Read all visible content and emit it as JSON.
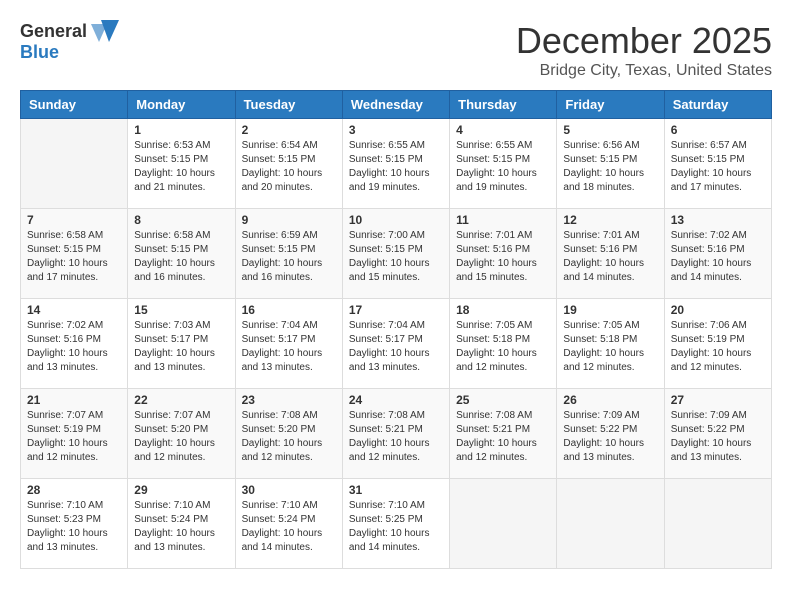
{
  "header": {
    "logo_general": "General",
    "logo_blue": "Blue",
    "month_title": "December 2025",
    "location": "Bridge City, Texas, United States"
  },
  "weekdays": [
    "Sunday",
    "Monday",
    "Tuesday",
    "Wednesday",
    "Thursday",
    "Friday",
    "Saturday"
  ],
  "weeks": [
    [
      {
        "day": "",
        "info": ""
      },
      {
        "day": "1",
        "info": "Sunrise: 6:53 AM\nSunset: 5:15 PM\nDaylight: 10 hours\nand 21 minutes."
      },
      {
        "day": "2",
        "info": "Sunrise: 6:54 AM\nSunset: 5:15 PM\nDaylight: 10 hours\nand 20 minutes."
      },
      {
        "day": "3",
        "info": "Sunrise: 6:55 AM\nSunset: 5:15 PM\nDaylight: 10 hours\nand 19 minutes."
      },
      {
        "day": "4",
        "info": "Sunrise: 6:55 AM\nSunset: 5:15 PM\nDaylight: 10 hours\nand 19 minutes."
      },
      {
        "day": "5",
        "info": "Sunrise: 6:56 AM\nSunset: 5:15 PM\nDaylight: 10 hours\nand 18 minutes."
      },
      {
        "day": "6",
        "info": "Sunrise: 6:57 AM\nSunset: 5:15 PM\nDaylight: 10 hours\nand 17 minutes."
      }
    ],
    [
      {
        "day": "7",
        "info": "Sunrise: 6:58 AM\nSunset: 5:15 PM\nDaylight: 10 hours\nand 17 minutes."
      },
      {
        "day": "8",
        "info": "Sunrise: 6:58 AM\nSunset: 5:15 PM\nDaylight: 10 hours\nand 16 minutes."
      },
      {
        "day": "9",
        "info": "Sunrise: 6:59 AM\nSunset: 5:15 PM\nDaylight: 10 hours\nand 16 minutes."
      },
      {
        "day": "10",
        "info": "Sunrise: 7:00 AM\nSunset: 5:15 PM\nDaylight: 10 hours\nand 15 minutes."
      },
      {
        "day": "11",
        "info": "Sunrise: 7:01 AM\nSunset: 5:16 PM\nDaylight: 10 hours\nand 15 minutes."
      },
      {
        "day": "12",
        "info": "Sunrise: 7:01 AM\nSunset: 5:16 PM\nDaylight: 10 hours\nand 14 minutes."
      },
      {
        "day": "13",
        "info": "Sunrise: 7:02 AM\nSunset: 5:16 PM\nDaylight: 10 hours\nand 14 minutes."
      }
    ],
    [
      {
        "day": "14",
        "info": "Sunrise: 7:02 AM\nSunset: 5:16 PM\nDaylight: 10 hours\nand 13 minutes."
      },
      {
        "day": "15",
        "info": "Sunrise: 7:03 AM\nSunset: 5:17 PM\nDaylight: 10 hours\nand 13 minutes."
      },
      {
        "day": "16",
        "info": "Sunrise: 7:04 AM\nSunset: 5:17 PM\nDaylight: 10 hours\nand 13 minutes."
      },
      {
        "day": "17",
        "info": "Sunrise: 7:04 AM\nSunset: 5:17 PM\nDaylight: 10 hours\nand 13 minutes."
      },
      {
        "day": "18",
        "info": "Sunrise: 7:05 AM\nSunset: 5:18 PM\nDaylight: 10 hours\nand 12 minutes."
      },
      {
        "day": "19",
        "info": "Sunrise: 7:05 AM\nSunset: 5:18 PM\nDaylight: 10 hours\nand 12 minutes."
      },
      {
        "day": "20",
        "info": "Sunrise: 7:06 AM\nSunset: 5:19 PM\nDaylight: 10 hours\nand 12 minutes."
      }
    ],
    [
      {
        "day": "21",
        "info": "Sunrise: 7:07 AM\nSunset: 5:19 PM\nDaylight: 10 hours\nand 12 minutes."
      },
      {
        "day": "22",
        "info": "Sunrise: 7:07 AM\nSunset: 5:20 PM\nDaylight: 10 hours\nand 12 minutes."
      },
      {
        "day": "23",
        "info": "Sunrise: 7:08 AM\nSunset: 5:20 PM\nDaylight: 10 hours\nand 12 minutes."
      },
      {
        "day": "24",
        "info": "Sunrise: 7:08 AM\nSunset: 5:21 PM\nDaylight: 10 hours\nand 12 minutes."
      },
      {
        "day": "25",
        "info": "Sunrise: 7:08 AM\nSunset: 5:21 PM\nDaylight: 10 hours\nand 12 minutes."
      },
      {
        "day": "26",
        "info": "Sunrise: 7:09 AM\nSunset: 5:22 PM\nDaylight: 10 hours\nand 13 minutes."
      },
      {
        "day": "27",
        "info": "Sunrise: 7:09 AM\nSunset: 5:22 PM\nDaylight: 10 hours\nand 13 minutes."
      }
    ],
    [
      {
        "day": "28",
        "info": "Sunrise: 7:10 AM\nSunset: 5:23 PM\nDaylight: 10 hours\nand 13 minutes."
      },
      {
        "day": "29",
        "info": "Sunrise: 7:10 AM\nSunset: 5:24 PM\nDaylight: 10 hours\nand 13 minutes."
      },
      {
        "day": "30",
        "info": "Sunrise: 7:10 AM\nSunset: 5:24 PM\nDaylight: 10 hours\nand 14 minutes."
      },
      {
        "day": "31",
        "info": "Sunrise: 7:10 AM\nSunset: 5:25 PM\nDaylight: 10 hours\nand 14 minutes."
      },
      {
        "day": "",
        "info": ""
      },
      {
        "day": "",
        "info": ""
      },
      {
        "day": "",
        "info": ""
      }
    ]
  ]
}
